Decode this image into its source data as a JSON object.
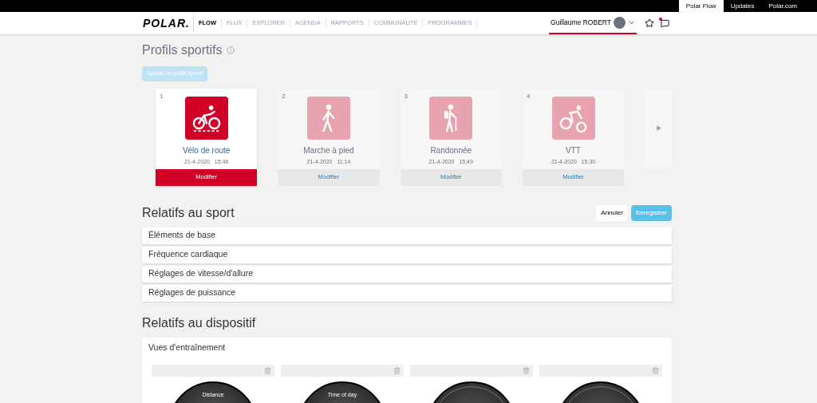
{
  "top_links": [
    {
      "label": "Polar Flow",
      "selected": true
    },
    {
      "label": "Updates",
      "selected": false
    },
    {
      "label": "Polar.com",
      "selected": false
    }
  ],
  "logo": "POLAR.",
  "nav": [
    {
      "label": "FLOW",
      "selected": true
    },
    {
      "label": "FLUX",
      "selected": false
    },
    {
      "label": "EXPLORER",
      "selected": false
    },
    {
      "label": "AGENDA",
      "selected": false
    },
    {
      "label": "RAPPORTS",
      "selected": false
    },
    {
      "label": "COMMUNAUTÉ",
      "selected": false
    },
    {
      "label": "PROGRAMMES",
      "selected": false
    }
  ],
  "user": {
    "name": "Guillaume ROBERT",
    "notification": true
  },
  "profiles": {
    "title": "Profils sportifs",
    "add_button": "Ajouter un profil sportif",
    "cards": [
      {
        "number": "1",
        "kind": "road-bike",
        "name": "Vélo de route",
        "date": "21-4-2020",
        "time": "15:46",
        "button": "Modifier",
        "selected": true
      },
      {
        "number": "2",
        "kind": "walking",
        "name": "Marche à pied",
        "date": "21-4-2020",
        "time": "11:14",
        "button": "Modifier",
        "selected": false
      },
      {
        "number": "3",
        "kind": "hiking",
        "name": "Randonnée",
        "date": "21-4-2020",
        "time": "15:49",
        "button": "Modifier",
        "selected": false
      },
      {
        "number": "4",
        "kind": "mtb",
        "name": "VTT",
        "date": "21-4-2020",
        "time": "15:30",
        "button": "Modifier",
        "selected": false
      }
    ]
  },
  "sport_settings": {
    "title": "Relatifs au sport",
    "cancel": "Annuler",
    "save": "Enregistrer",
    "sections": [
      "Éléments de base",
      "Fréquence cardiaque",
      "Réglages de vitesse/d'allure",
      "Réglages de puissance"
    ]
  },
  "device_settings": {
    "title": "Relatifs au dispositif",
    "panel_title": "Vues d'entraînement",
    "views": [
      {
        "kind": "labeled",
        "label": "Distance"
      },
      {
        "kind": "labeled",
        "label": "Time of day"
      },
      {
        "kind": "ringed"
      },
      {
        "kind": "ringed"
      }
    ]
  }
}
